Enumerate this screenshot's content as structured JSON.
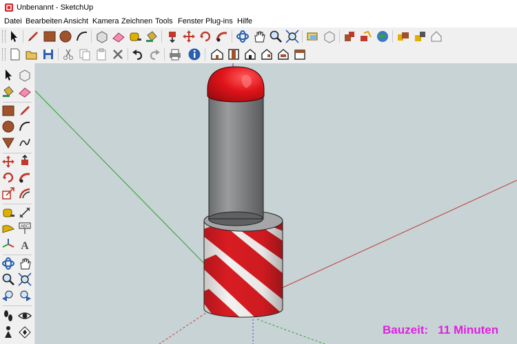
{
  "window": {
    "title": "Unbenannt - SketchUp"
  },
  "menu": {
    "items": [
      "Datei",
      "Bearbeiten",
      "Ansicht",
      "Kamera",
      "Zeichnen",
      "Tools",
      "Fenster",
      "Plug-ins",
      "Hilfe"
    ]
  },
  "toolbar_row1": {
    "icons": [
      "select-icon",
      "pencil-line-icon",
      "rectangle-icon",
      "circle-icon",
      "arc-icon",
      "component-icon",
      "eraser-icon",
      "tape-measure-icon",
      "paint-bucket-icon",
      "push-pull-icon",
      "move-icon",
      "rotate-icon",
      "follow-me-icon",
      "orbit-icon",
      "pan-icon",
      "zoom-icon",
      "zoom-extents-icon",
      "get-models-icon",
      "share-model-icon",
      "component-window-icon",
      "google-earth-icon",
      "photo-textures-icon",
      "warehouse-icon",
      "extension-icon"
    ]
  },
  "toolbar_row2": {
    "icons": [
      "new-file-icon",
      "open-file-icon",
      "save-icon",
      "cut-icon",
      "copy-icon",
      "paste-icon",
      "delete-icon",
      "undo-icon",
      "redo-icon",
      "print-icon",
      "model-info-icon",
      "iso-view-icon",
      "top-view-icon",
      "front-view-icon",
      "right-view-icon",
      "back-view-icon"
    ]
  },
  "left_toolbar": {
    "icons": [
      "select-icon",
      "make-component-icon",
      "paint-bucket-icon",
      "eraser-icon",
      "rectangle-icon",
      "line-icon",
      "circle-icon",
      "arc-icon",
      "polygon-icon",
      "freehand-icon",
      "move-icon",
      "push-pull-icon",
      "rotate-icon",
      "follow-me-icon",
      "scale-icon",
      "offset-icon",
      "tape-measure-icon",
      "dimension-icon",
      "protractor-icon",
      "text-icon",
      "axes-icon",
      "3d-text-icon",
      "orbit-icon",
      "pan-icon",
      "zoom-icon",
      "zoom-window-icon",
      "previous-view-icon",
      "next-view-icon",
      "walk-icon",
      "look-around-icon",
      "position-camera-icon",
      "section-plane-icon"
    ]
  },
  "viewport": {
    "background_color": "#c7d3d4",
    "overlay_text": "Bauzeit:   11 Minuten",
    "overlay_color": "#e020e0"
  },
  "model": {
    "cap_color": "#e0141a",
    "shaft_color": "#7c7e80",
    "stripe_red": "#d81c22",
    "stripe_white": "#f4f2f0"
  },
  "axes": {
    "red": "#c23a3a",
    "green": "#2aa02a",
    "blue": "#3a3ad0"
  }
}
